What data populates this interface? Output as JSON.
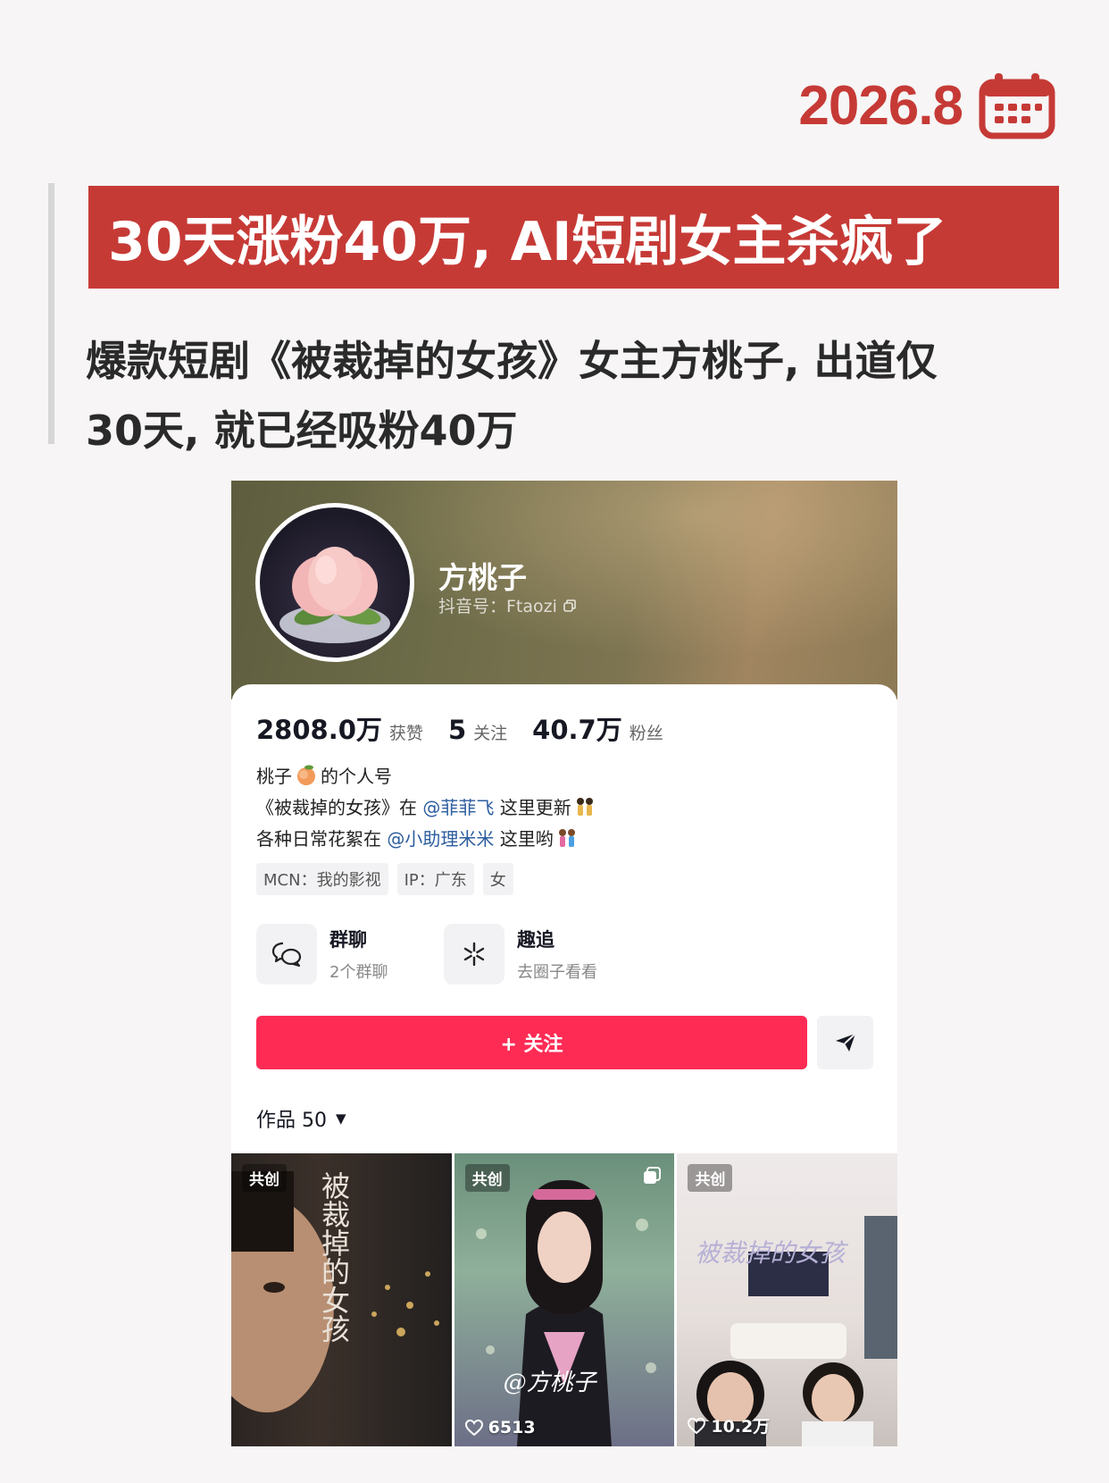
{
  "date": "2026.8",
  "headline": "30天涨粉40万, AI短剧女主杀疯了",
  "subtitle_line1": "爆款短剧《被裁掉的女孩》女主方桃子, 出道仅",
  "subtitle_line2": "30天, 就已经吸粉40万",
  "profile": {
    "name": "方桃子",
    "douyin_id": "抖音号：Ftaozi",
    "stats": [
      {
        "value": "2808.0万",
        "label": "获赞"
      },
      {
        "value": "5",
        "label": "关注"
      },
      {
        "value": "40.7万",
        "label": "粉丝"
      }
    ],
    "bio": {
      "line1_a": "桃子",
      "line1_b": "的个人号",
      "line2_a": "《被裁掉的女孩》在",
      "line2_mention": "@菲菲飞",
      "line2_b": "这里更新",
      "line3_a": "各种日常花絮在",
      "line3_mention": "@小助理米米",
      "line3_b": "这里哟"
    },
    "tags": [
      "MCN：我的影视",
      "IP：广东",
      "女"
    ],
    "features": [
      {
        "title": "群聊",
        "sub": "2个群聊",
        "icon": "chat-bubble-icon"
      },
      {
        "title": "趣追",
        "sub": "去圈子看看",
        "icon": "sparkle-icon"
      }
    ],
    "follow_label": "+ 关注",
    "works_label": "作品 50",
    "thumbs": [
      {
        "badge": "共创",
        "vertical_title": "被裁掉的女孩",
        "likes": ""
      },
      {
        "badge": "共创",
        "handwrite": "@方桃子",
        "likes": "6513"
      },
      {
        "badge": "共创",
        "script": "被裁掉的女孩",
        "likes": "10.2万"
      }
    ]
  },
  "colors": {
    "accent_red": "#c63a36",
    "follow_pink": "#fe2c55",
    "mention_blue": "#2c5d9e"
  }
}
